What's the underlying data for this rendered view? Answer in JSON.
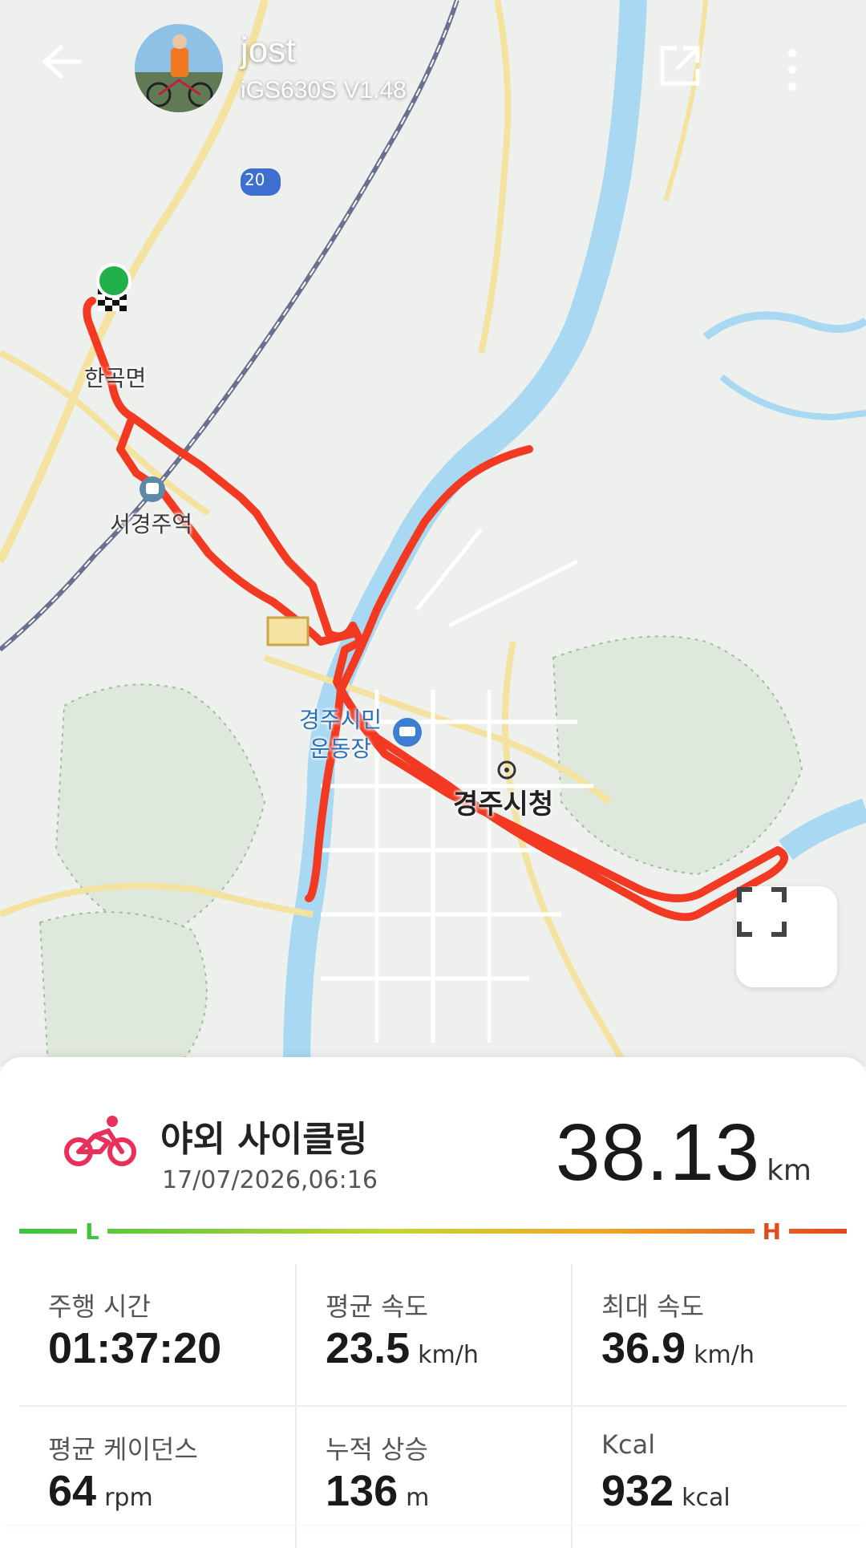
{
  "header": {
    "user_name": "jost",
    "device": "iGS630S  V1.48"
  },
  "map": {
    "labels": {
      "town": "한곡면",
      "station": "서경주역",
      "stadium": "경주시민\n운동장",
      "city_hall": "경주시청",
      "highway_shield": "20"
    },
    "colors": {
      "route": "#f23a22",
      "water": "#a9d8f2",
      "road": "#f7e7a6",
      "railway": "#6a7090",
      "park": "#dfe8dc",
      "start_marker": "#22b04a"
    }
  },
  "activity": {
    "title": "야외 사이클링",
    "datetime": "17/07/2026,06:16",
    "distance": "38.13",
    "distance_unit": "km",
    "icon": "bicycle-icon",
    "icon_color": "#e8305a"
  },
  "intensity_scale": {
    "low": "L",
    "high": "H"
  },
  "stats": [
    {
      "label": "주행 시간",
      "value": "01:37:20",
      "unit": ""
    },
    {
      "label": "평균 속도",
      "value": "23.5",
      "unit": "km/h"
    },
    {
      "label": "최대 속도",
      "value": "36.9",
      "unit": "km/h"
    },
    {
      "label": "평균 케이던스",
      "value": "64",
      "unit": "rpm"
    },
    {
      "label": "누적 상승",
      "value": "136",
      "unit": "m"
    },
    {
      "label": "Kcal",
      "value": "932",
      "unit": "kcal"
    }
  ]
}
